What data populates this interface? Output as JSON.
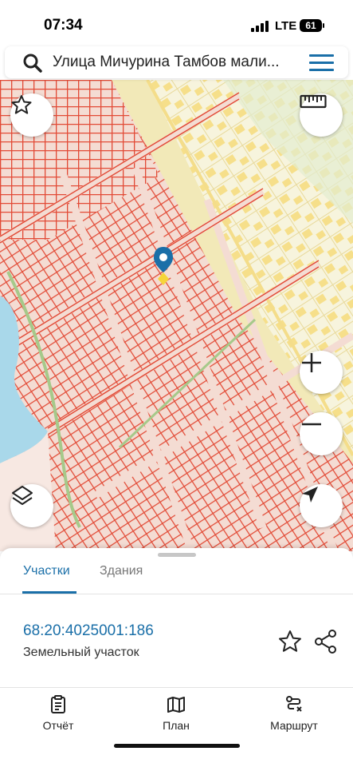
{
  "status_bar": {
    "time": "07:34",
    "network": "LTE",
    "battery": "61"
  },
  "search": {
    "query": "Улица Мичурина Тамбов мали..."
  },
  "map": {
    "controls": {
      "favorite": "star-icon",
      "ruler": "ruler-icon",
      "zoom_in": "plus-icon",
      "zoom_out": "minus-icon",
      "layers": "layers-icon",
      "locate": "navigation-arrow-icon"
    },
    "colors": {
      "parcel_line": "#e24a36",
      "parcel_fill": "#f4dcd3",
      "building": "#f6df8a",
      "road": "#f0e6b0",
      "water": "#a9d8ea",
      "pin": "#1a6fa8"
    }
  },
  "sheet": {
    "tabs": [
      {
        "label": "Участки",
        "active": true
      },
      {
        "label": "Здания",
        "active": false
      }
    ],
    "parcel": {
      "cadastral_number": "68:20:4025001:186",
      "type": "Земельный участок"
    }
  },
  "bottom_nav": [
    {
      "label": "Отчёт",
      "icon": "report-icon"
    },
    {
      "label": "План",
      "icon": "map-icon"
    },
    {
      "label": "Маршрут",
      "icon": "route-icon"
    }
  ],
  "accent": "#1a6fa8"
}
